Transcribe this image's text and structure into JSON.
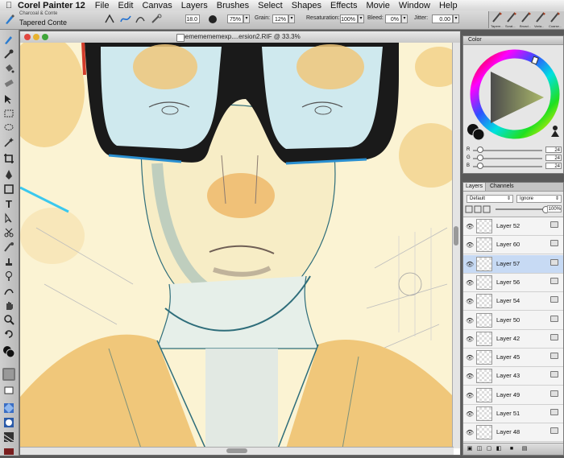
{
  "app": {
    "name": "Corel Painter 12"
  },
  "menu": [
    "File",
    "Edit",
    "Canvas",
    "Layers",
    "Brushes",
    "Select",
    "Shapes",
    "Effects",
    "Movie",
    "Window",
    "Help"
  ],
  "property_bar": {
    "brush_category": "Charcoal & Conte",
    "brush_variant": "Tapered Conte",
    "size": "18.0",
    "opacity": "75%",
    "grain_label": "Grain:",
    "grain": "12%",
    "resaturation_label": "Resaturation:",
    "resaturation": "100%",
    "bleed_label": "Bleed:",
    "bleed": "0%",
    "jitter_label": "Jitter:",
    "jitter": "0.00"
  },
  "brush_library": [
    "Tapere...",
    "Scrat...",
    "Broad...",
    "Varia...",
    "Coarse..."
  ],
  "document": {
    "title": "mememememexp....ersion2.RIF @ 33.3%"
  },
  "color_panel": {
    "title": "Color",
    "accent": "#8fa13a",
    "rgb": [
      {
        "label": "R",
        "value": "24"
      },
      {
        "label": "G",
        "value": "24"
      },
      {
        "label": "B",
        "value": "24"
      }
    ]
  },
  "layers_panel": {
    "tabs": [
      "Layers",
      "Channels"
    ],
    "composite_method": "Default",
    "composite_depth": "Ignore",
    "opacity": "100%",
    "layers": [
      {
        "name": "Layer 52",
        "selected": false
      },
      {
        "name": "Layer 60",
        "selected": false
      },
      {
        "name": "Layer 57",
        "selected": true
      },
      {
        "name": "Layer 56",
        "selected": false
      },
      {
        "name": "Layer 54",
        "selected": false
      },
      {
        "name": "Layer 50",
        "selected": false
      },
      {
        "name": "Layer 42",
        "selected": false
      },
      {
        "name": "Layer 45",
        "selected": false
      },
      {
        "name": "Layer 43",
        "selected": false
      },
      {
        "name": "Layer 49",
        "selected": false
      },
      {
        "name": "Layer 51",
        "selected": false
      },
      {
        "name": "Layer 48",
        "selected": false
      }
    ]
  }
}
